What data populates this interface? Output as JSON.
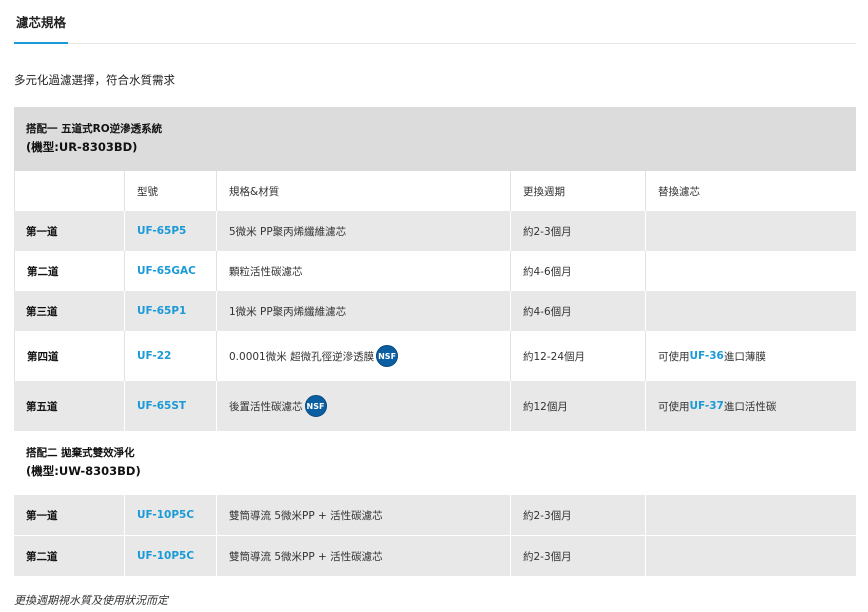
{
  "tabs": [
    {
      "label": "濾芯規格"
    }
  ],
  "intro": "多元化過濾選擇，符合水質需求",
  "config1": {
    "title": "搭配一 五道式RO逆滲透系統",
    "model": "(機型:UR-8303BD)"
  },
  "headers": [
    "",
    "型號",
    "規格&材質",
    "更換週期",
    "替換濾芯"
  ],
  "rows1": [
    {
      "stage": "第一道",
      "model": "UF-65P5",
      "spec": "5微米 PP聚丙烯纖維濾芯",
      "nsf": false,
      "cycle": "約2-3個月",
      "replace_pre": "",
      "replace_link": "",
      "replace_post": ""
    },
    {
      "stage": "第二道",
      "model": "UF-65GAC",
      "spec": "顆粒活性碳濾芯",
      "nsf": false,
      "cycle": "約4-6個月",
      "replace_pre": "",
      "replace_link": "",
      "replace_post": ""
    },
    {
      "stage": "第三道",
      "model": "UF-65P1",
      "spec": "1微米 PP聚丙烯纖維濾芯",
      "nsf": false,
      "cycle": "約4-6個月",
      "replace_pre": "",
      "replace_link": "",
      "replace_post": ""
    },
    {
      "stage": "第四道",
      "model": "UF-22",
      "spec": "0.0001微米 超微孔徑逆滲透膜",
      "nsf": true,
      "cycle": "約12-24個月",
      "replace_pre": "可使用",
      "replace_link": "UF-36",
      "replace_post": "進口薄膜"
    },
    {
      "stage": "第五道",
      "model": "UF-65ST",
      "spec": "後置活性碳濾芯",
      "nsf": true,
      "cycle": "約12個月",
      "replace_pre": "可使用",
      "replace_link": "UF-37",
      "replace_post": "進口活性碳"
    }
  ],
  "config2": {
    "title": "搭配二 拋棄式雙效淨化",
    "model": "(機型:UW-8303BD)"
  },
  "rows2": [
    {
      "stage": "第一道",
      "model": "UF-10P5C",
      "spec": "雙筒導流 5微米PP + 活性碳濾芯",
      "cycle": "約2-3個月"
    },
    {
      "stage": "第二道",
      "model": "UF-10P5C",
      "spec": "雙筒導流 5微米PP + 活性碳濾芯",
      "cycle": "約2-3個月"
    }
  ],
  "nsf_label": "NSF",
  "footnote": "更換週期視水質及使用狀況而定",
  "colors": {
    "accent": "#1a9ad6",
    "nsf_badge": "#0a5fa3",
    "row_alt": "#e8e8e8",
    "section": "#dcdcdc"
  }
}
